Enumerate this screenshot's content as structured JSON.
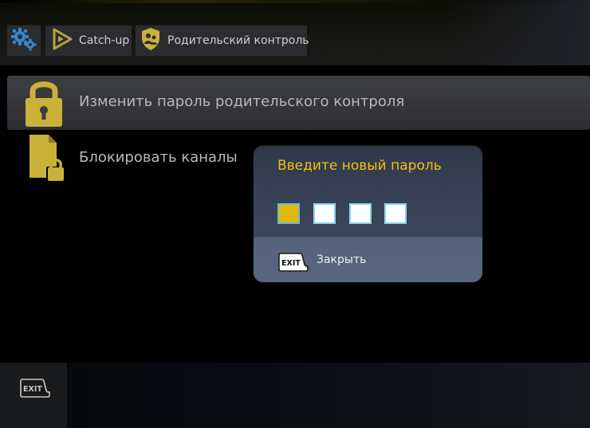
{
  "header": {
    "catchup_label": "Catch-up",
    "parental_label": "Родительский контроль",
    "icons": {
      "settings": "gears-icon",
      "catchup": "play-triangle-icon",
      "parental": "shield-family-icon"
    }
  },
  "menu": {
    "items": [
      {
        "label": "Изменить пароль родительского контроля",
        "icon": "padlock-icon",
        "selected": true
      },
      {
        "label": "Блокировать каналы",
        "icon": "document-lock-icon",
        "selected": false
      }
    ]
  },
  "dialog": {
    "title": "Введите новый пароль",
    "pin_length": 4,
    "active_index": 0,
    "exit_key": "EXIT",
    "close_label": "Закрыть"
  },
  "footer": {
    "exit_key": "EXIT"
  },
  "colors": {
    "accent": "#f2c10f",
    "icon_gold": "#c9b13a",
    "dialog_bg": "#3a4353",
    "dialog_footer": "#58667d"
  }
}
